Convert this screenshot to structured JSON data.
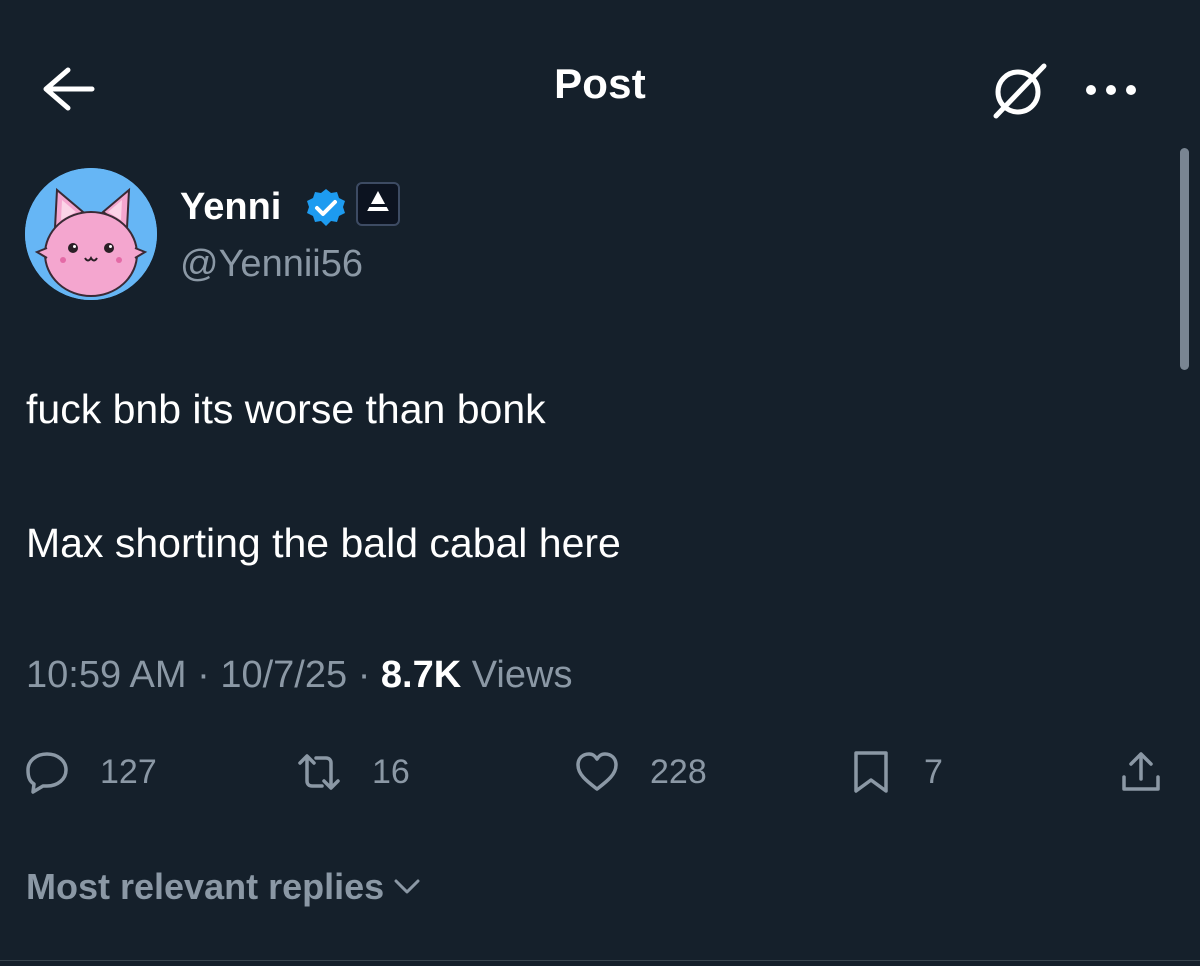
{
  "header": {
    "title": "Post",
    "back_icon": "arrow-left-icon",
    "grok_icon": "grok-icon",
    "more_icon": "more-horizontal-icon"
  },
  "author": {
    "name": "Yenni",
    "handle": "@Yennii56",
    "verified_icon": "verified-badge-icon",
    "affiliate_icon": "affiliate-badge-icon",
    "avatar": "pink-cat-avatar"
  },
  "post": {
    "lines": [
      "fuck bnb its worse than bonk",
      "Max shorting the bald cabal here"
    ]
  },
  "meta": {
    "time": "10:59 AM",
    "separator": " · ",
    "date": "10/7/25",
    "views_count": "8.7K",
    "views_label": " Views"
  },
  "actions": {
    "reply_count": "127",
    "repost_count": "16",
    "like_count": "228",
    "bookmark_count": "7"
  },
  "replies": {
    "sort_label": "Most relevant replies"
  },
  "colors": {
    "background": "#15202b",
    "text": "#ffffff",
    "secondary_text": "#8b98a5",
    "verified_blue": "#1d9bf0",
    "avatar_bg": "#66b6f5",
    "avatar_cat": "#f4a6cf"
  }
}
